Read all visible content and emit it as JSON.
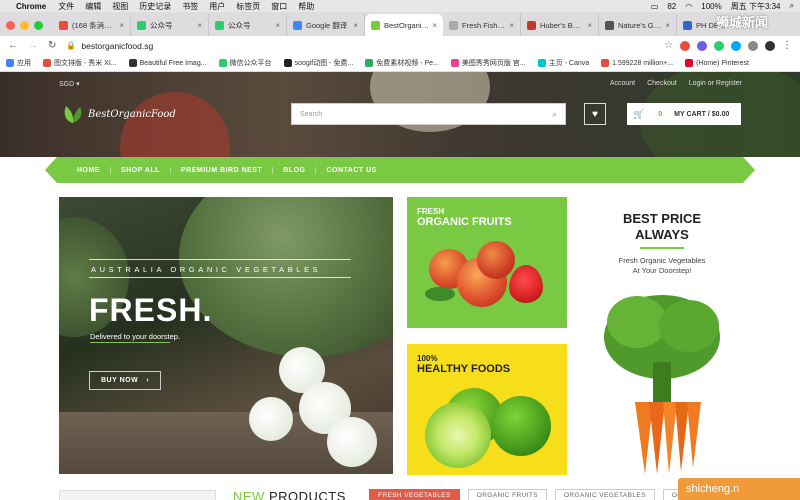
{
  "os_menubar": {
    "app_name": "Chrome",
    "menus": [
      "文件",
      "编辑",
      "视图",
      "历史记录",
      "书签",
      "用户",
      "标签页",
      "窗口",
      "帮助"
    ],
    "battery": "82",
    "battery_pct": "100%",
    "clock": "周五 下午3:34"
  },
  "browser": {
    "tabs": [
      {
        "title": "(168 条消息) ...",
        "color": "#e74c3c"
      },
      {
        "title": "公众号",
        "color": "#2ecc71"
      },
      {
        "title": "公众号",
        "color": "#2ecc71"
      },
      {
        "title": "Google 翻译",
        "color": "#4285f4"
      },
      {
        "title": "BestOrganicFo...",
        "color": "#7ac943",
        "active": true
      },
      {
        "title": "Fresh Fish Sli...",
        "color": "#aaaaaa"
      },
      {
        "title": "Huber's Butch...",
        "color": "#c0392b"
      },
      {
        "title": "Nature's Glory...",
        "color": "#555555"
      },
      {
        "title": "PH DELI",
        "color": "#3366cc"
      }
    ],
    "url": "bestorganicfood.sg",
    "bookmarks": [
      {
        "label": "应用",
        "color": "#4285f4"
      },
      {
        "label": "图文排版 - 秀米 XI...",
        "color": "#e74c3c"
      },
      {
        "label": "Beautiful Free Imag...",
        "color": "#333333"
      },
      {
        "label": "微信公众平台",
        "color": "#2ecc71"
      },
      {
        "label": "soogif动图 - 免费...",
        "color": "#222222"
      },
      {
        "label": "免费素材视频 - Pe...",
        "color": "#27ae60"
      },
      {
        "label": "美图秀秀网页版 官...",
        "color": "#e84393"
      },
      {
        "label": "主页 - Canva",
        "color": "#00c4cc"
      },
      {
        "label": "1.599228 million+...",
        "color": "#e74c3c"
      },
      {
        "label": "(Home) Pinterest",
        "color": "#e60023"
      }
    ]
  },
  "site": {
    "currency": "SGD",
    "top_links": [
      "Account",
      "Checkout",
      "Login or Register"
    ],
    "logo_text": "BestOrganicFood",
    "search_placeholder": "Search",
    "cart_count": "0",
    "cart_label": "MY CART / $0.00",
    "nav": [
      "HOME",
      "SHOP ALL",
      "PREMIUM BIRD NEST",
      "BLOG",
      "CONTACT US"
    ],
    "banner": {
      "eyebrow": "AUSTRALIA ORGANIC VEGETABLES",
      "headline": "FRESH.",
      "subline": "Delivered to your doorstep.",
      "cta": "BUY NOW"
    },
    "fruits_panel": {
      "kicker": "FRESH",
      "title": "ORGANIC FRUITS"
    },
    "healthy_panel": {
      "kicker": "100%",
      "title": "HEALTHY FOODS"
    },
    "best_price": {
      "line1": "BEST PRICE",
      "line2": "ALWAYS",
      "sub1": "Fresh Organic Vegetables",
      "sub2": "At Your Doorstep!"
    },
    "products": {
      "heading_accent": "NEW",
      "heading_rest": " PRODUCTS",
      "tabs": [
        "FRESH VEGETABLES",
        "ORGANIC FRUITS",
        "ORGANIC VEGETABLES",
        "ORGANIC"
      ]
    }
  },
  "watermarks": {
    "top_right": "狮城新闻",
    "bottom_right": "shicheng.n"
  },
  "colors": {
    "brand_green": "#7ac943",
    "accent_red": "#e05b4a",
    "yellow": "#f7de1a"
  }
}
